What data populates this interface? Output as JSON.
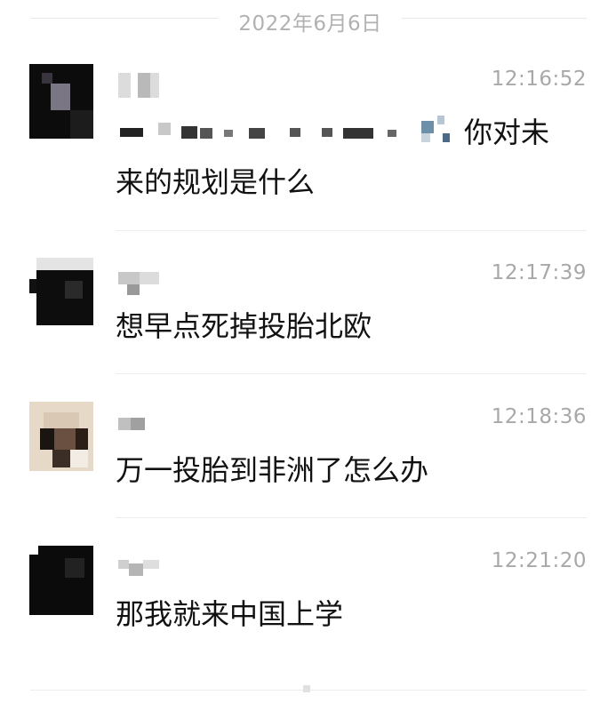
{
  "date_divider": "2022年6月6日",
  "messages": [
    {
      "time": "12:16:52",
      "text_visible": "你对未",
      "text_line2": "来的规划是什么"
    },
    {
      "time": "12:17:39",
      "text": "想早点死掉投胎北欧"
    },
    {
      "time": "12:18:36",
      "text": "万一投胎到非洲了怎么办"
    },
    {
      "time": "12:21:20",
      "text": "那我就来中国上学"
    }
  ]
}
